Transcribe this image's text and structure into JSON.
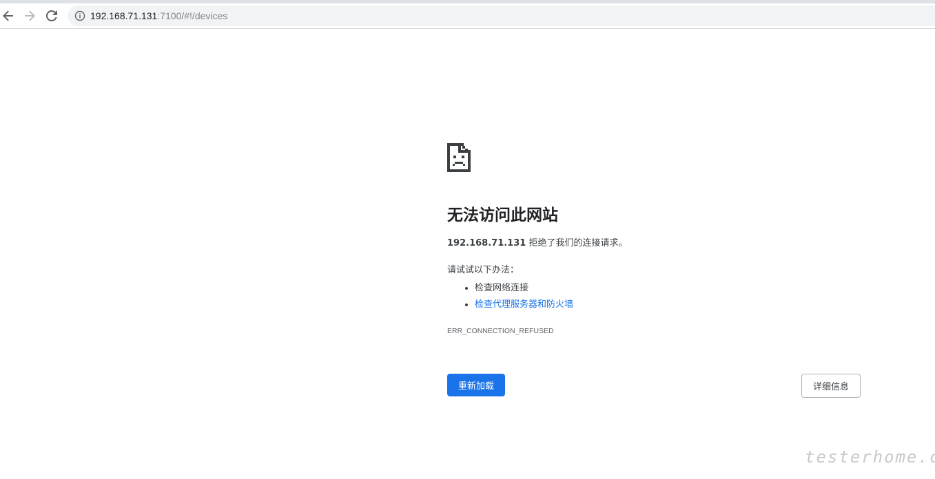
{
  "browser": {
    "url_host": "192.168.71.131",
    "url_rest": ":7100/#!/devices",
    "icons": {
      "back": "arrow-left-icon",
      "forward": "arrow-right-icon",
      "reload": "reload-icon",
      "site_info": "info-icon"
    }
  },
  "error_page": {
    "icon": "sad-document-icon",
    "title": "无法访问此网站",
    "host": "192.168.71.131",
    "message": " 拒绝了我们的连接请求。",
    "try_text": "请试试以下办法：",
    "suggestions": [
      {
        "label": "检查网络连接",
        "is_link": false
      },
      {
        "label": "检查代理服务器和防火墙",
        "is_link": true
      }
    ],
    "error_code": "ERR_CONNECTION_REFUSED",
    "reload_label": "重新加载",
    "details_label": "详细信息"
  },
  "watermark": "testerhome.com",
  "colors": {
    "accent": "#1a73e8",
    "text": "#3c4043",
    "title": "#202124",
    "omnibox_bg": "#f1f3f4"
  }
}
